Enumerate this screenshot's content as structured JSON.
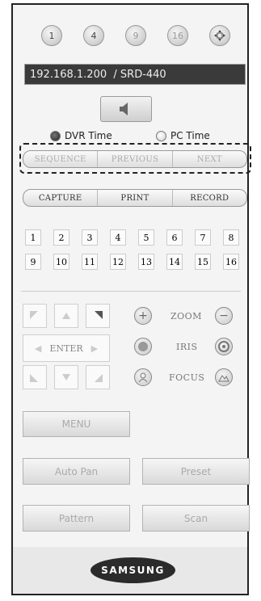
{
  "channel_views": [
    "1",
    "4",
    "9",
    "16"
  ],
  "connection": {
    "address": "192.168.1.200",
    "separator": "/",
    "model": "SRD-440"
  },
  "time_mode": {
    "dvr_label": "DVR Time",
    "pc_label": "PC Time",
    "selected": "DVR Time"
  },
  "playback_bar": [
    "SEQUENCE",
    "PREVIOUS",
    "NEXT"
  ],
  "action_bar": [
    "CAPTURE",
    "PRINT",
    "RECORD"
  ],
  "channels": [
    "1",
    "2",
    "3",
    "4",
    "5",
    "6",
    "7",
    "8",
    "9",
    "10",
    "11",
    "12",
    "13",
    "14",
    "15",
    "16"
  ],
  "ptz": {
    "enter_label": "ENTER",
    "zoom_label": "ZOOM",
    "iris_label": "IRIS",
    "focus_label": "FOCUS"
  },
  "buttons": {
    "menu": "MENU",
    "auto_pan": "Auto Pan",
    "preset": "Preset",
    "pattern": "Pattern",
    "scan": "Scan"
  },
  "brand": "SAMSUNG"
}
